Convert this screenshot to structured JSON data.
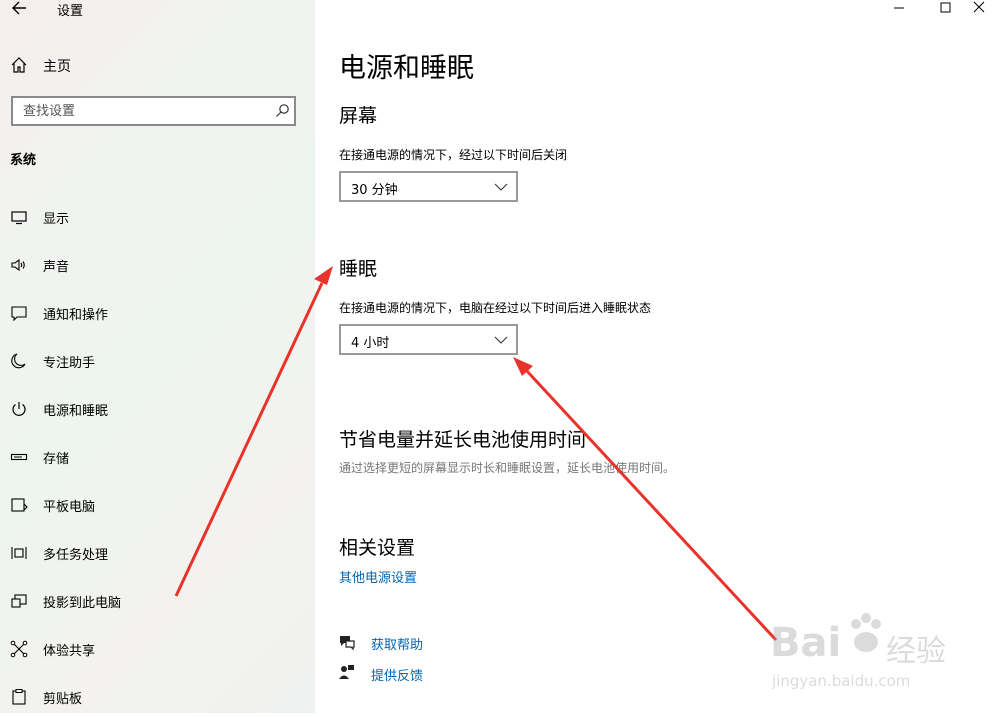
{
  "window": {
    "title": "设置",
    "minimize_icon": "minimize-icon",
    "maximize_icon": "maximize-icon",
    "close_icon": "close-icon"
  },
  "sidebar": {
    "home_label": "主页",
    "search_placeholder": "查找设置",
    "section_label": "系统",
    "items": [
      {
        "label": "显示",
        "icon": "display-icon"
      },
      {
        "label": "声音",
        "icon": "speaker-icon"
      },
      {
        "label": "通知和操作",
        "icon": "notification-icon"
      },
      {
        "label": "专注助手",
        "icon": "moon-icon"
      },
      {
        "label": "电源和睡眠",
        "icon": "power-icon"
      },
      {
        "label": "存储",
        "icon": "storage-icon"
      },
      {
        "label": "平板电脑",
        "icon": "tablet-icon"
      },
      {
        "label": "多任务处理",
        "icon": "multitask-icon"
      },
      {
        "label": "投影到此电脑",
        "icon": "project-icon"
      },
      {
        "label": "体验共享",
        "icon": "share-icon"
      },
      {
        "label": "剪贴板",
        "icon": "clipboard-icon"
      }
    ]
  },
  "main": {
    "title": "电源和睡眠",
    "screen": {
      "heading": "屏幕",
      "description": "在接通电源的情况下，经过以下时间后关闭",
      "value": "30 分钟"
    },
    "sleep": {
      "heading": "睡眠",
      "description": "在接通电源的情况下，电脑在经过以下时间后进入睡眠状态",
      "value": "4 小时"
    },
    "battery": {
      "heading": "节省电量并延长电池使用时间",
      "description": "通过选择更短的屏幕显示时长和睡眠设置，延长电池使用时间。"
    },
    "related": {
      "heading": "相关设置",
      "link": "其他电源设置"
    },
    "help": {
      "get_help": "获取帮助",
      "feedback": "提供反馈"
    }
  },
  "watermark": {
    "brand": "Bai",
    "brand_cn": "经验",
    "url": "jingyan.baidu.com"
  },
  "colors": {
    "accent": "#0066b4",
    "annotation_arrow": "#e8322a",
    "sidebar_bg": "#f1f3f0"
  }
}
